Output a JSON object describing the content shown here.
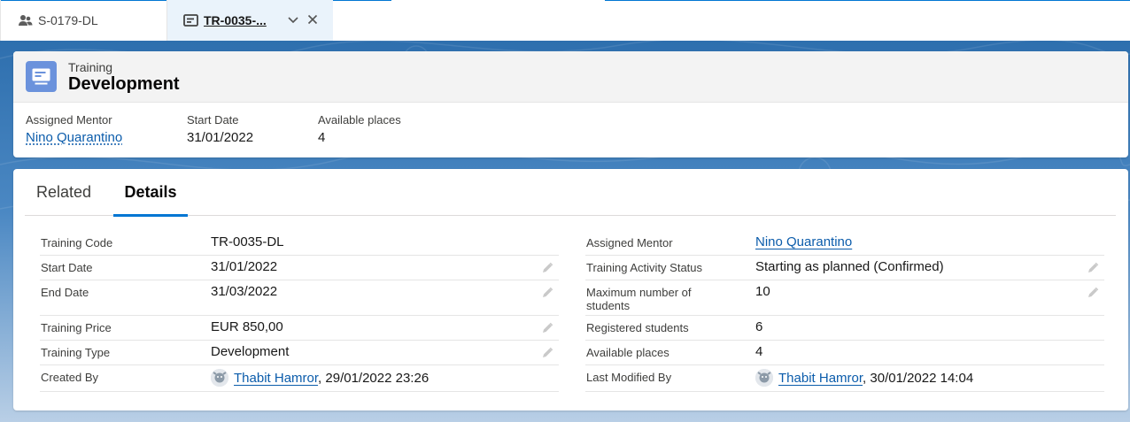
{
  "tabs": [
    {
      "label": "S-0179-DL",
      "icon": "user-group-icon"
    },
    {
      "label": "TR-0035-...",
      "icon": "training-record-icon"
    }
  ],
  "record": {
    "object_type": "Training",
    "title": "Development",
    "icon": "training-record-icon",
    "icon_color": "#6b92dc",
    "highlights": [
      {
        "label": "Assigned Mentor",
        "value": "Nino Quarantino"
      },
      {
        "label": "Start Date",
        "value": "31/01/2022"
      },
      {
        "label": "Available places",
        "value": "4"
      }
    ]
  },
  "panel_tabs": [
    "Related",
    "Details"
  ],
  "active_panel_tab": "Details",
  "details": {
    "left": [
      {
        "label": "Training Code",
        "value": "TR-0035-DL"
      },
      {
        "label": "Start Date",
        "value": "31/01/2022",
        "editable": true
      },
      {
        "label": "End Date",
        "value": "31/03/2022",
        "editable": true
      },
      {
        "label": "Training Price",
        "value": "EUR 850,00",
        "editable": true
      },
      {
        "label": "Training Type",
        "value": "Development",
        "editable": true
      },
      {
        "label": "Created By",
        "user": "Thabit Hamror",
        "stamp": ", 29/01/2022 23:26"
      }
    ],
    "right": [
      {
        "label": "Assigned Mentor",
        "value": "Nino Quarantino"
      },
      {
        "label": "Training Activity Status",
        "value": "Starting as planned (Confirmed)",
        "editable": true
      },
      {
        "label": "Maximum number of students",
        "value": "10",
        "editable": true
      },
      {
        "label": "Registered students",
        "value": "6"
      },
      {
        "label": "Available places",
        "value": "4"
      },
      {
        "label": "Last Modified By",
        "user": "Thabit Hamror",
        "stamp": ", 30/01/2022 14:04"
      }
    ]
  },
  "colors": {
    "accent": "#0176d3",
    "link": "#0b5cab",
    "background_top": "#2e6fae"
  }
}
